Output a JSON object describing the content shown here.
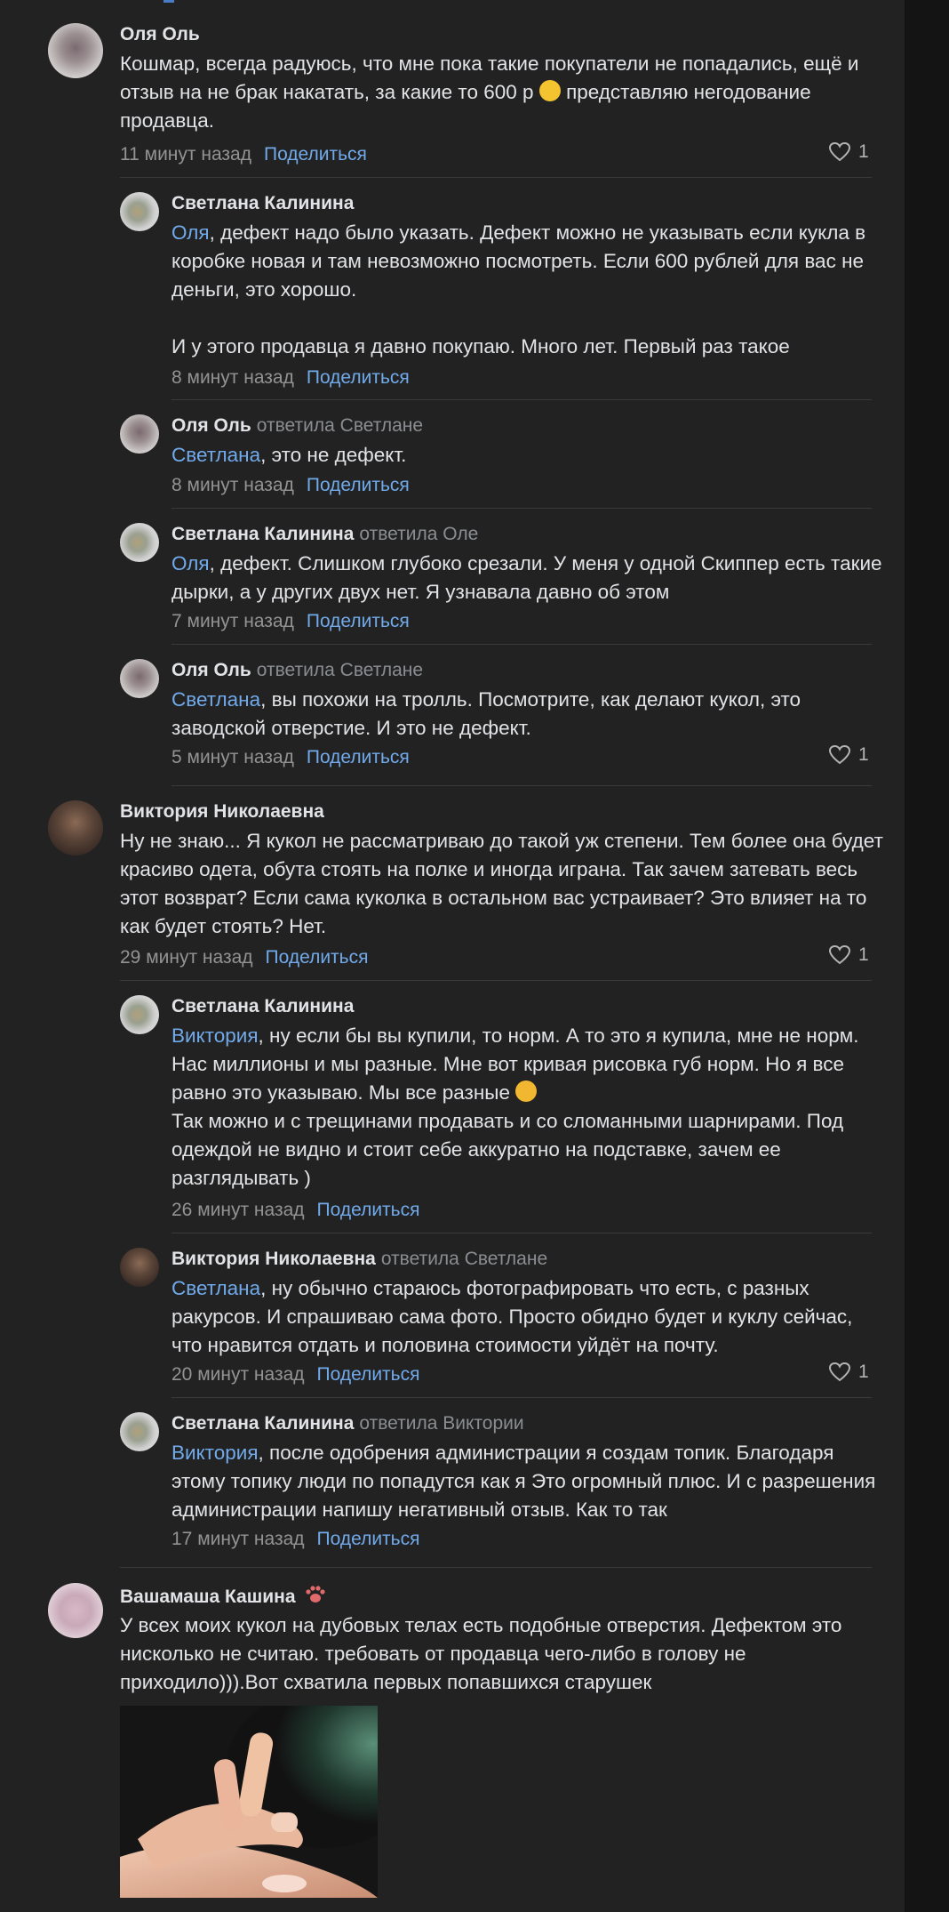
{
  "comments": [
    {
      "author": "Оля Оль",
      "replied_to": "",
      "mention": "",
      "text": "Кошмар, всегда радуюсь, что мне пока такие покупатели не попадались, ещё и отзыв на не брак накатать, за какие то 600 р",
      "text_after_emoji": " представляю негодование продавца.",
      "time": "11 минут назад",
      "share": "Поделиться",
      "likes": "1"
    },
    {
      "author": "Светлана Калинина",
      "replied_to": "",
      "mention": "Оля",
      "text": ", дефект надо было указать. Дефект можно не указывать если кукла в коробке новая и там невозможно посмотреть. Если 600 рублей для вас не деньги, это хорошо.",
      "text2": "И у этого продавца я давно покупаю. Много лет. Первый раз такое",
      "time": "8 минут назад",
      "share": "Поделиться"
    },
    {
      "author": "Оля Оль",
      "replied_to": "ответила Светлане",
      "mention": "Светлана",
      "text": ", это не дефект.",
      "time": "8 минут назад",
      "share": "Поделиться"
    },
    {
      "author": "Светлана Калинина",
      "replied_to": "ответила Оле",
      "mention": "Оля",
      "text": ", дефект. Слишком глубоко срезали. У меня у одной Скиппер есть такие дырки, а у других двух нет. Я узнавала давно об этом",
      "time": "7 минут назад",
      "share": "Поделиться"
    },
    {
      "author": "Оля Оль",
      "replied_to": "ответила Светлане",
      "mention": "Светлана",
      "text": ", вы похожи на тролль. Посмотрите, как делают кукол, это заводской отверстие. И это не дефект.",
      "time": "5 минут назад",
      "share": "Поделиться",
      "likes": "1"
    },
    {
      "author": "Виктория Николаевна",
      "replied_to": "",
      "mention": "",
      "text": "Ну не знаю... Я кукол не рассматриваю до такой уж степени. Тем более она будет красиво одета, обута стоять на полке и иногда играна. Так зачем затевать весь этот возврат? Если сама куколка в остальном вас устраивает? Это влияет на то как будет стоять? Нет.",
      "time": "29 минут назад",
      "share": "Поделиться",
      "likes": "1"
    },
    {
      "author": "Светлана Калинина",
      "replied_to": "",
      "mention": "Виктория",
      "text": ", ну если бы вы купили, то норм. А то это я купила, мне не норм. Нас миллионы и мы разные. Мне вот кривая рисовка губ норм. Но я все равно это указываю. Мы все разные",
      "text2": "Так можно и с трещинами продавать и со сломанными шарнирами. Под одеждой не видно и стоит себе аккуратно на подставке, зачем ее разглядывать )",
      "time": "26 минут назад",
      "share": "Поделиться"
    },
    {
      "author": "Виктория Николаевна",
      "replied_to": "ответила Светлане",
      "mention": "Светлана",
      "text": ", ну обычно стараюсь фотографировать что есть, с разных ракурсов. И спрашиваю сама фото. Просто обидно будет и куклу сейчас, что нравится отдать и половина стоимости уйдёт на почту.",
      "time": "20 минут назад",
      "share": "Поделиться",
      "likes": "1"
    },
    {
      "author": "Светлана Калинина",
      "replied_to": "ответила Виктории",
      "mention": "Виктория",
      "text": ", после одобрения администрации я создам топик. Благодаря этому топику люди по попадутся как я Это огромный плюс. И с разрешения администрации напишу негативный отзыв. Как то так",
      "time": "17 минут назад",
      "share": "Поделиться"
    },
    {
      "author": "Вашамаша Кашина",
      "replied_to": "",
      "mention": "",
      "text": "У всех моих кукол на дубовых телах есть подобные отверстия. Дефектом это нисколько не считаю. требовать от продавца чего-либо в голову не приходило))).Вот схватила первых попавшихся старушек"
    }
  ],
  "icons": {
    "heart": "heart-icon",
    "paw": "paw-badge-icon",
    "emoji_smile": "smiling-face-emoji",
    "emoji_hug": "hugging-face-emoji"
  },
  "colors": {
    "background": "#222222",
    "link": "#71aaeb",
    "text": "#e1e3e6",
    "meta": "#939393"
  }
}
